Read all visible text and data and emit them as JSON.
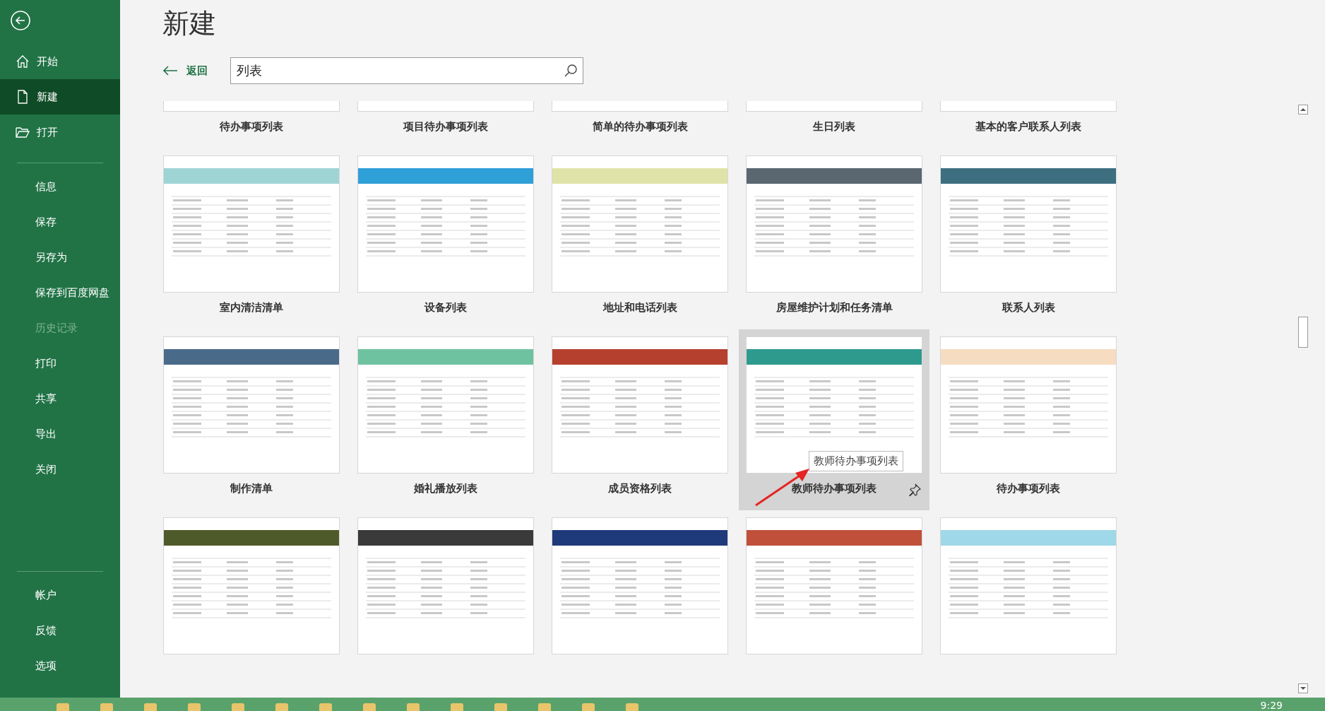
{
  "sidebar": {
    "items": [
      {
        "label": "开始",
        "selected": false,
        "disabled": false
      },
      {
        "label": "新建",
        "selected": true,
        "disabled": false
      },
      {
        "label": "打开",
        "selected": false,
        "disabled": false
      }
    ],
    "items_middle": [
      {
        "label": "信息",
        "disabled": false
      },
      {
        "label": "保存",
        "disabled": false
      },
      {
        "label": "另存为",
        "disabled": false
      },
      {
        "label": "保存到百度网盘",
        "disabled": false
      },
      {
        "label": "历史记录",
        "disabled": true
      },
      {
        "label": "打印",
        "disabled": false
      },
      {
        "label": "共享",
        "disabled": false
      },
      {
        "label": "导出",
        "disabled": false
      },
      {
        "label": "关闭",
        "disabled": false
      }
    ],
    "items_bottom": [
      {
        "label": "帐户"
      },
      {
        "label": "反馈"
      },
      {
        "label": "选项"
      }
    ]
  },
  "title": "新建",
  "back_link": "返回",
  "search": {
    "value": "列表"
  },
  "templates": [
    {
      "name": "待办事项列表",
      "selected": false
    },
    {
      "name": "项目待办事项列表",
      "selected": false
    },
    {
      "name": "简单的待办事项列表",
      "selected": false
    },
    {
      "name": "生日列表",
      "selected": false
    },
    {
      "name": "基本的客户联系人列表",
      "selected": false
    },
    {
      "name": "室内清洁清单",
      "color": "#9fd4d4",
      "selected": false
    },
    {
      "name": "设备列表",
      "color": "#2f9fd8",
      "selected": false
    },
    {
      "name": "地址和电话列表",
      "color": "#dfe3a8",
      "selected": false
    },
    {
      "name": "房屋维护计划和任务清单",
      "color": "#5a6670",
      "selected": false
    },
    {
      "name": "联系人列表",
      "color": "#3d6f80",
      "selected": false
    },
    {
      "name": "制作清单",
      "color": "#4a6a8a",
      "selected": false
    },
    {
      "name": "婚礼播放列表",
      "color": "#6fc2a0",
      "selected": false
    },
    {
      "name": "成员资格列表",
      "color": "#b5402e",
      "selected": false
    },
    {
      "name": "教师待办事项列表",
      "color": "#2e9a8e",
      "selected": true
    },
    {
      "name": "待办事项列表",
      "color": "#f6dcc0",
      "selected": false
    },
    {
      "color": "#4f5a2a",
      "selected": false
    },
    {
      "color": "#3a3a3a",
      "selected": false
    },
    {
      "color": "#1f3a7a",
      "selected": false
    },
    {
      "color": "#c0503a",
      "selected": false
    },
    {
      "color": "#9fd8e8",
      "selected": false
    }
  ],
  "tooltip": "教师待办事项列表",
  "clock": "9:29"
}
